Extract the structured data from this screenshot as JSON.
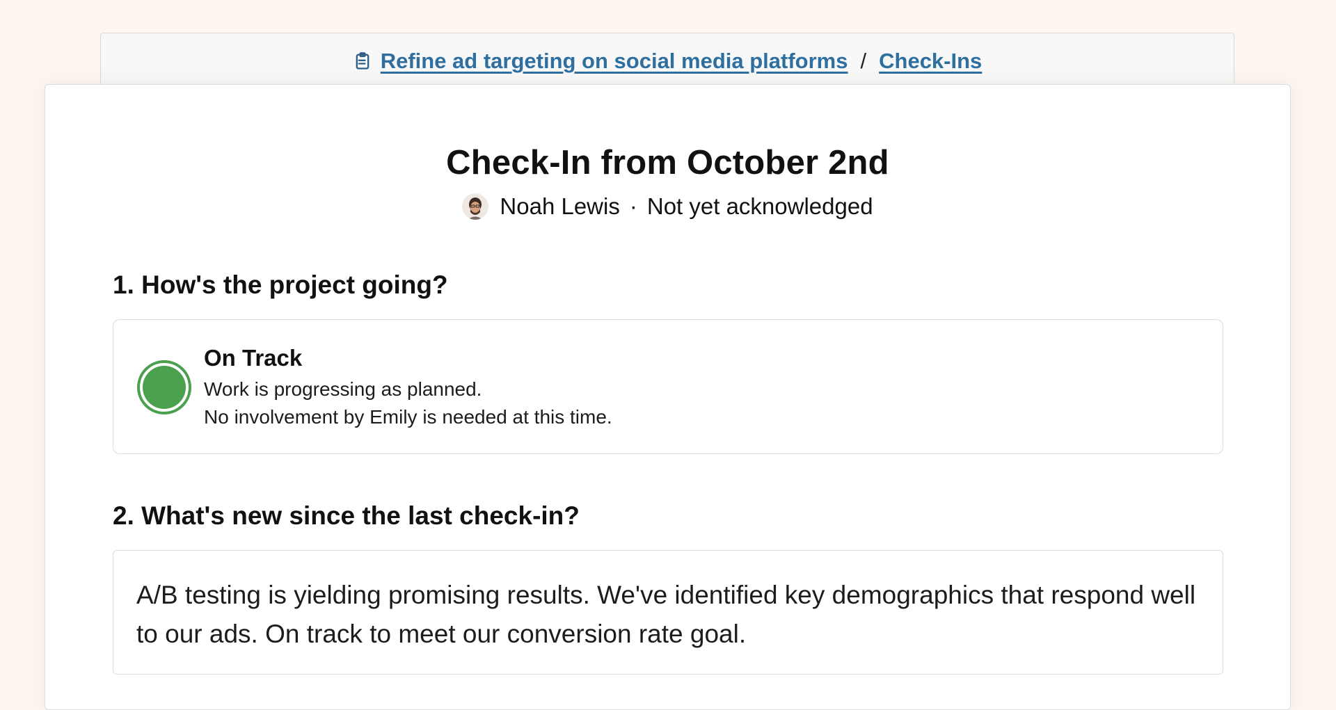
{
  "breadcrumb": {
    "project": "Refine ad targeting on social media platforms",
    "separator": "/",
    "section": "Check-Ins"
  },
  "checkin": {
    "title": "Check-In from October 2nd",
    "author": "Noah Lewis",
    "dot": "·",
    "ack_status": "Not yet acknowledged"
  },
  "questions": [
    {
      "heading": "1. How's the project going?",
      "status": {
        "label": "On Track",
        "color": "#4aa04f",
        "line1": "Work is progressing as planned.",
        "line2": "No involvement by Emily is needed at this time."
      }
    },
    {
      "heading": "2. What's new since the last check-in?",
      "answer": "A/B testing is yielding promising results. We've identified key demographics that respond well to our ads. On track to meet our conversion rate goal."
    }
  ],
  "icons": {
    "breadcrumb_icon": "clipboard-icon",
    "avatar": "avatar",
    "status_icon": "status-circle-icon"
  },
  "colors": {
    "link": "#2f6f9f",
    "background": "#fdf6f1",
    "on_track": "#4aa04f"
  }
}
